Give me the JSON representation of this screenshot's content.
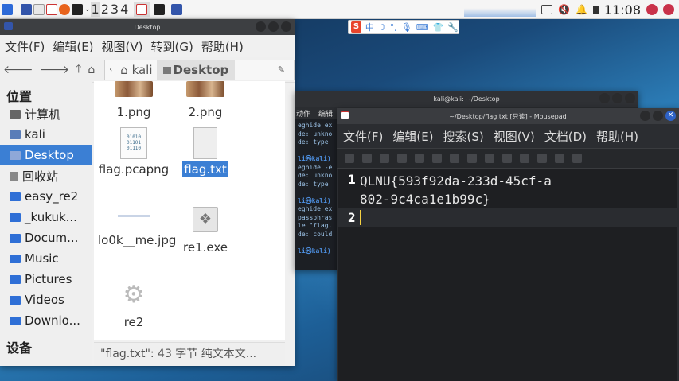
{
  "panel": {
    "workspaces": [
      "1",
      "2",
      "3",
      "4"
    ],
    "clock": "11:08"
  },
  "sogou": {
    "logo": "S",
    "mode": "中"
  },
  "file_manager": {
    "title": "Desktop",
    "menu": [
      "文件(F)",
      "编辑(E)",
      "视图(V)",
      "转到(G)",
      "帮助(H)"
    ],
    "path": {
      "home": "kali",
      "current": "Desktop"
    },
    "sidebar": {
      "places_header": "位置",
      "items": [
        "计算机",
        "kali",
        "Desktop",
        "回收站",
        "easy_re2",
        "_kukuk...",
        "Docum...",
        "Music",
        "Pictures",
        "Videos",
        "Downlo..."
      ],
      "devices_header": "设备"
    },
    "files": [
      {
        "name": "1.png"
      },
      {
        "name": "2.png"
      },
      {
        "name": "flag.pcapng",
        "icon_text": "01010\n01101\n01110"
      },
      {
        "name": "flag.txt"
      },
      {
        "name": "lo0k__me.jpg"
      },
      {
        "name": "re1.exe"
      },
      {
        "name": "re2"
      }
    ],
    "status": "\"flag.txt\": 43 字节 纯文本文..."
  },
  "terminal": {
    "title": "kali@kali: ~/Desktop",
    "menu": [
      "动作",
      "编辑"
    ],
    "lines": [
      "eghide ex",
      "de: unkno",
      "de: type",
      "",
      "li㉿kali)",
      "eghide -e",
      "de: unkno",
      "de: type",
      "",
      "li㉿kali)",
      "eghide ex",
      "passphras",
      "le \"flag.",
      "de: could",
      "",
      "li㉿kali)"
    ]
  },
  "mousepad": {
    "title": "~/Desktop/flag.txt [只读] - Mousepad",
    "menu": [
      "文件(F)",
      "编辑(E)",
      "搜索(S)",
      "视图(V)",
      "文档(D)",
      "帮助(H)"
    ],
    "lines": [
      {
        "num": "1",
        "text": "QLNU{593f92da-233d-45cf-a802-9c4ca1e1b99c}"
      },
      {
        "num": "2",
        "text": ""
      }
    ]
  },
  "colors": {
    "selection": "#3b7fd4",
    "panel_bg": "#f5f5f5",
    "title_bar": "#3d3f42",
    "editor_bg": "#1e1f22",
    "caret": "#f5d142"
  }
}
